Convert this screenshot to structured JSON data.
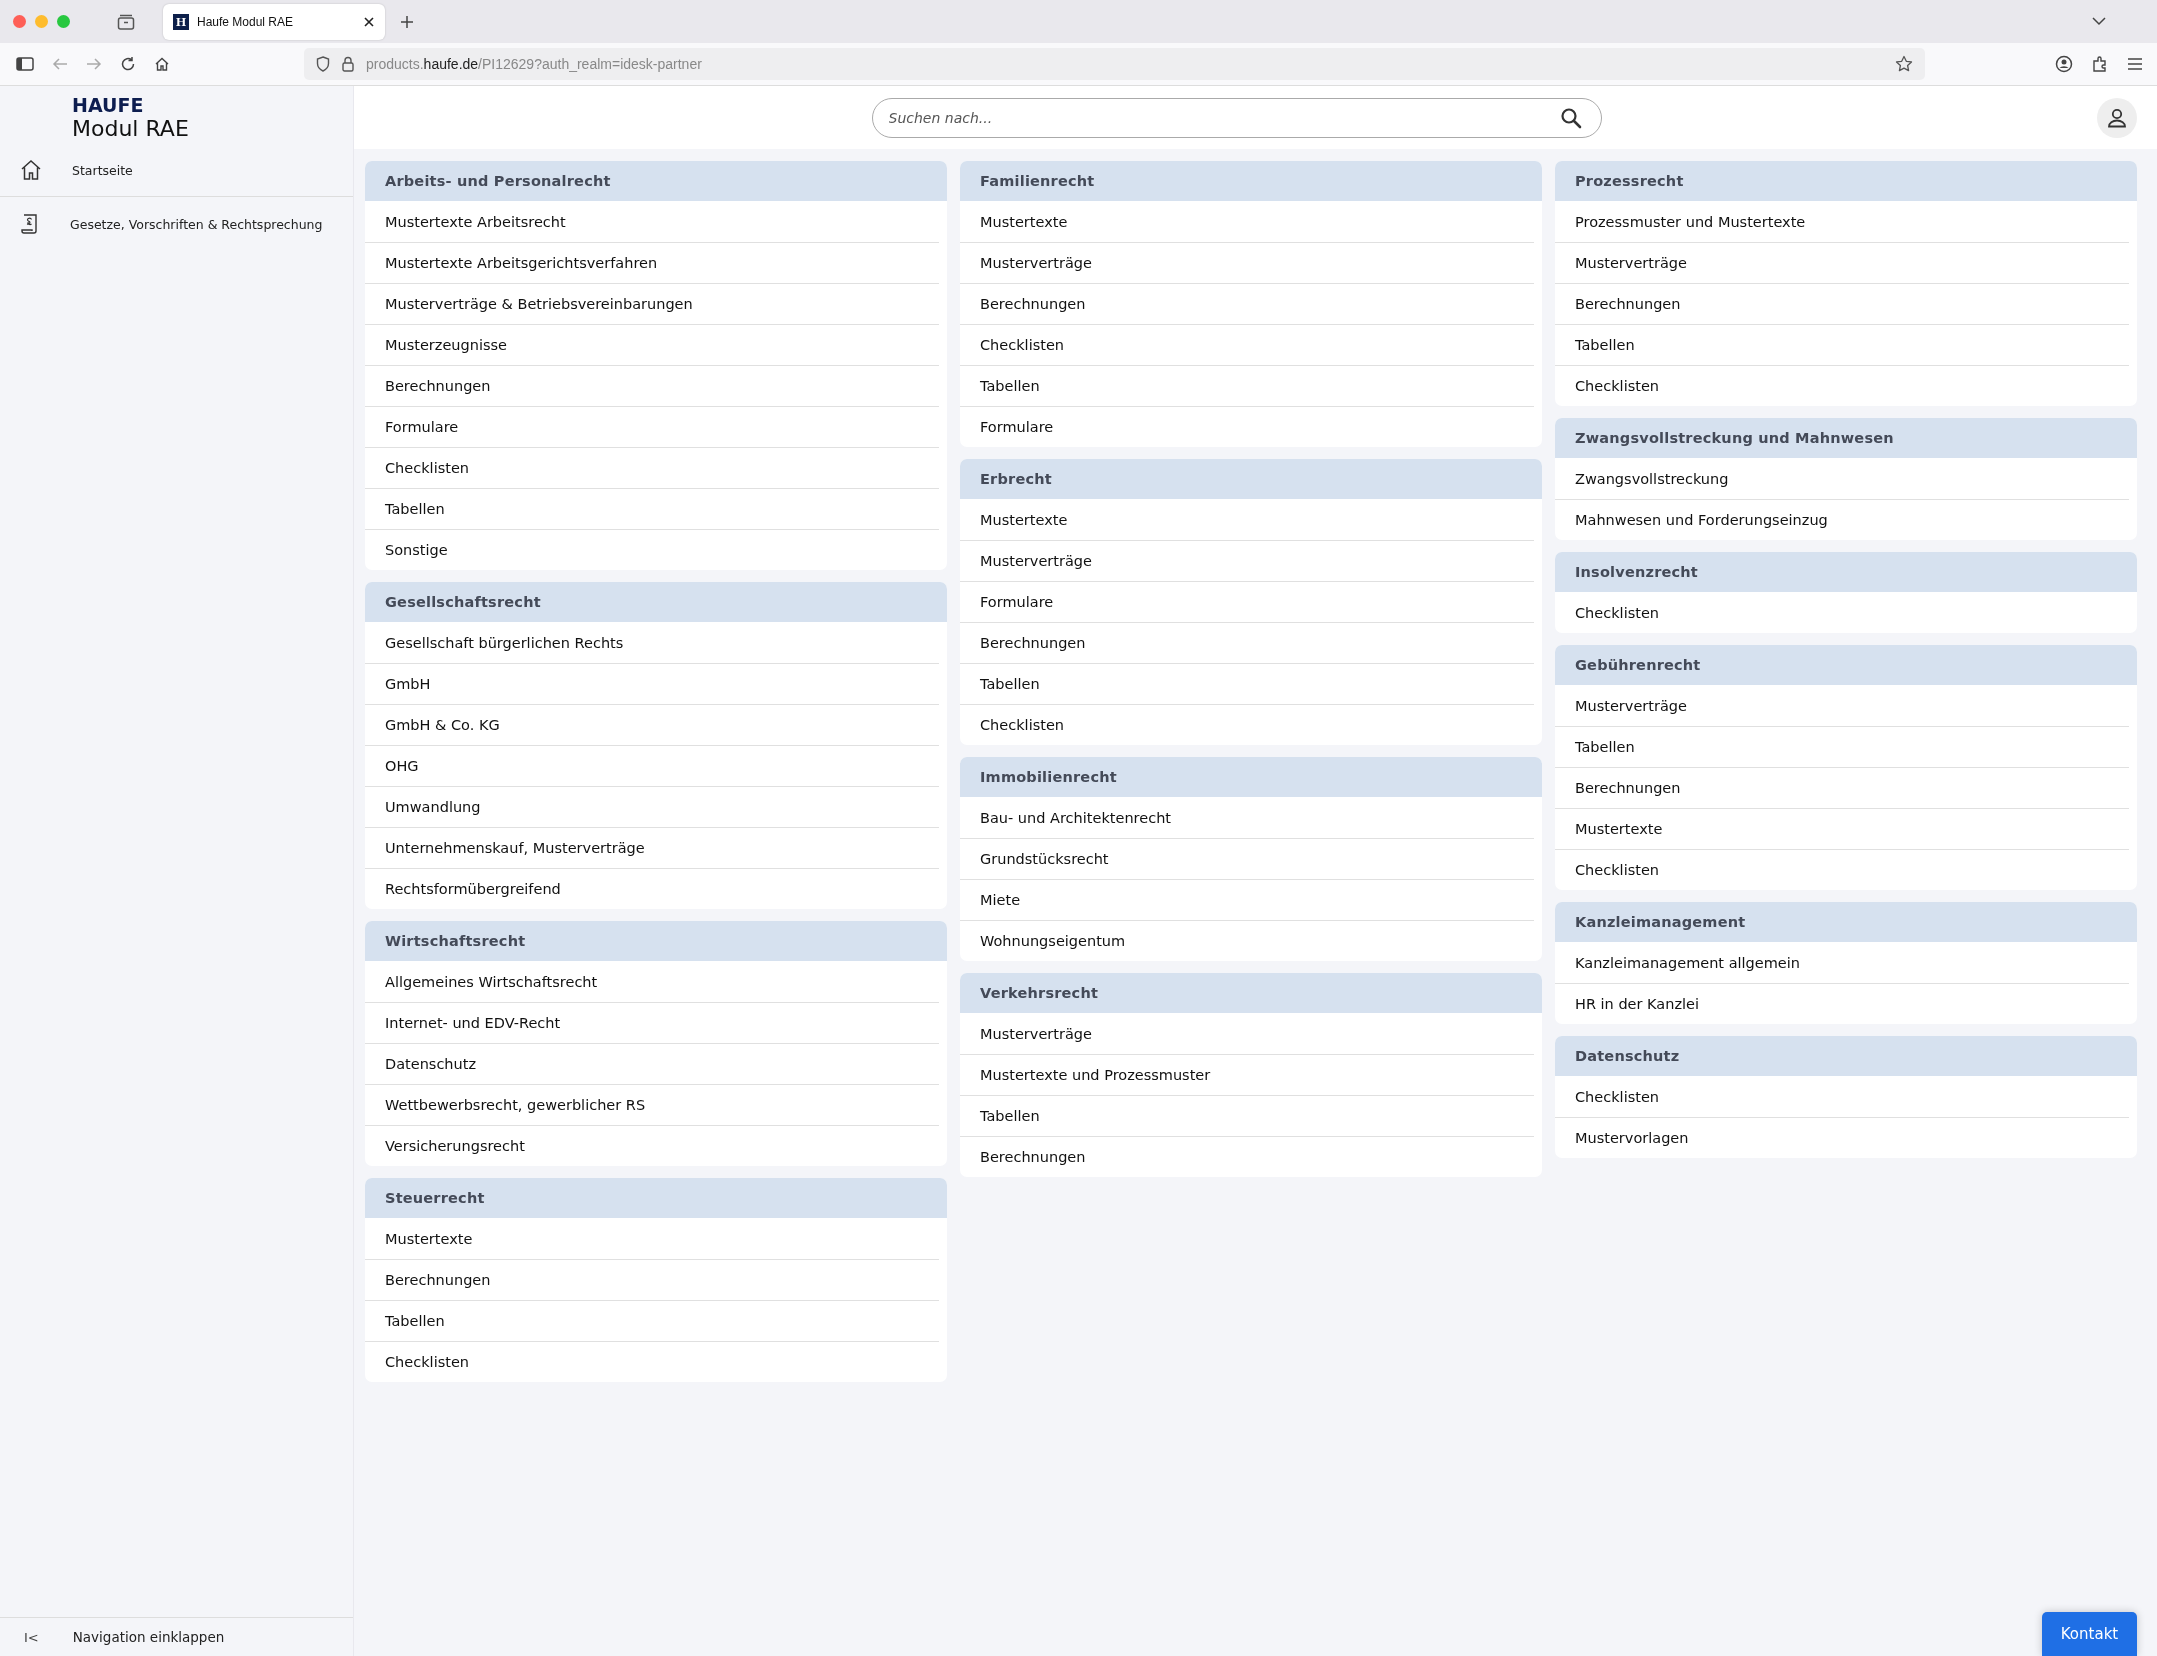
{
  "browser": {
    "tab_title": "Haufe Modul RAE",
    "tab_logo": "H",
    "url_prefix": "products.",
    "url_domain": "haufe.de",
    "url_path": "/PI12629?auth_realm=idesk-partner"
  },
  "sidebar": {
    "brand": "HAUFE",
    "product": "Modul RAE",
    "items": [
      {
        "label": "Startseite",
        "kind": "home"
      },
      {
        "label": "Gesetze, Vorschriften & Rechtsprechung",
        "kind": "law"
      }
    ],
    "collapse": {
      "icon": "I<",
      "label": "Navigation einklappen"
    }
  },
  "search": {
    "placeholder": "Suchen nach..."
  },
  "columns": [
    {
      "sections": [
        {
          "title": "Arbeits- und Personalrecht",
          "items": [
            "Mustertexte Arbeitsrecht",
            "Mustertexte Arbeitsgerichtsverfahren",
            "Musterverträge & Betriebsvereinbarungen",
            "Musterzeugnisse",
            "Berechnungen",
            "Formulare",
            "Checklisten",
            "Tabellen",
            "Sonstige"
          ]
        },
        {
          "title": "Gesellschaftsrecht",
          "items": [
            "Gesellschaft bürgerlichen Rechts",
            "GmbH",
            "GmbH & Co. KG",
            "OHG",
            "Umwandlung",
            "Unternehmenskauf, Musterverträge",
            "Rechtsformübergreifend"
          ]
        },
        {
          "title": "Wirtschaftsrecht",
          "items": [
            "Allgemeines Wirtschaftsrecht",
            "Internet- und EDV-Recht",
            "Datenschutz",
            "Wettbewerbsrecht, gewerblicher RS",
            "Versicherungsrecht"
          ]
        },
        {
          "title": "Steuerrecht",
          "items": [
            "Mustertexte",
            "Berechnungen",
            "Tabellen",
            "Checklisten"
          ]
        }
      ]
    },
    {
      "sections": [
        {
          "title": "Familienrecht",
          "items": [
            "Mustertexte",
            "Musterverträge",
            "Berechnungen",
            "Checklisten",
            "Tabellen",
            "Formulare"
          ]
        },
        {
          "title": "Erbrecht",
          "items": [
            "Mustertexte",
            "Musterverträge",
            "Formulare",
            "Berechnungen",
            "Tabellen",
            "Checklisten"
          ]
        },
        {
          "title": "Immobilienrecht",
          "items": [
            "Bau- und Architektenrecht",
            "Grundstücksrecht",
            "Miete",
            "Wohnungseigentum"
          ]
        },
        {
          "title": "Verkehrsrecht",
          "items": [
            "Musterverträge",
            "Mustertexte und Prozessmuster",
            "Tabellen",
            "Berechnungen"
          ]
        }
      ]
    },
    {
      "sections": [
        {
          "title": "Prozessrecht",
          "items": [
            "Prozessmuster und Mustertexte",
            "Musterverträge",
            "Berechnungen",
            "Tabellen",
            "Checklisten"
          ]
        },
        {
          "title": "Zwangsvollstreckung und Mahnwesen",
          "items": [
            "Zwangsvollstreckung",
            "Mahnwesen und Forderungseinzug"
          ]
        },
        {
          "title": "Insolvenzrecht",
          "items": [
            "Checklisten"
          ]
        },
        {
          "title": "Gebührenrecht",
          "items": [
            "Musterverträge",
            "Tabellen",
            "Berechnungen",
            "Mustertexte",
            "Checklisten"
          ]
        },
        {
          "title": "Kanzleimanagement",
          "items": [
            "Kanzleimanagement allgemein",
            "HR in der Kanzlei"
          ]
        },
        {
          "title": "Datenschutz",
          "items": [
            "Checklisten",
            "Mustervorlagen"
          ]
        }
      ]
    }
  ],
  "contact_button": "Kontakt"
}
